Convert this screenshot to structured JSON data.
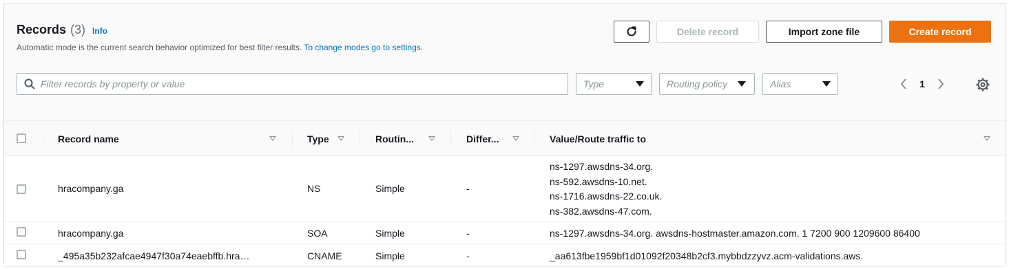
{
  "header": {
    "title": "Records",
    "count": "(3)",
    "info_link": "Info",
    "description": "Automatic mode is the current search behavior optimized for best filter results.",
    "description_link": "To change modes go to settings."
  },
  "actions": {
    "refresh_icon": "refresh-icon",
    "delete_label": "Delete record",
    "import_label": "Import zone file",
    "create_label": "Create record"
  },
  "filters": {
    "search_placeholder": "Filter records by property or value",
    "type_placeholder": "Type",
    "routing_placeholder": "Routing policy",
    "alias_placeholder": "Alias"
  },
  "pagination": {
    "current_page": "1"
  },
  "table": {
    "columns": [
      "Record name",
      "Type",
      "Routin...",
      "Differ...",
      "Value/Route traffic to"
    ],
    "rows": [
      {
        "name": "hracompany.ga",
        "type": "NS",
        "routing": "Simple",
        "differentiator": "-",
        "values": [
          "ns-1297.awsdns-34.org.",
          "ns-592.awsdns-10.net.",
          "ns-1716.awsdns-22.co.uk.",
          "ns-382.awsdns-47.com."
        ]
      },
      {
        "name": "hracompany.ga",
        "type": "SOA",
        "routing": "Simple",
        "differentiator": "-",
        "values": [
          "ns-1297.awsdns-34.org. awsdns-hostmaster.amazon.com. 1 7200 900 1209600 86400"
        ]
      },
      {
        "name": "_495a35b232afcae4947f30a74eaebffb.hra…",
        "type": "CNAME",
        "routing": "Simple",
        "differentiator": "-",
        "values": [
          "_aa613fbe1959bf1d01092f20348b2cf3.mybbdzzyvz.acm-validations.aws."
        ]
      }
    ]
  },
  "colors": {
    "accent": "#ec7211",
    "link": "#0073bb",
    "border": "#d5dbdb"
  }
}
